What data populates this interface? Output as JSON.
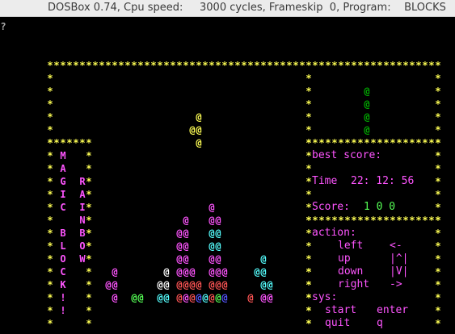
{
  "window": {
    "title": "DOSBox 0.74, Cpu speed:     3000 cycles, Frameskip  0, Program:    BLOCKS"
  },
  "colors": {
    "border": "#ffff55",
    "label": "#ff55ff",
    "score_value": "#55ff55",
    "next_piece": "#00aa00",
    "cursor": "#aaaaaa"
  },
  "game": {
    "title_letters": [
      "M",
      "A",
      "G",
      "I",
      "C",
      "",
      "B",
      "L",
      "O",
      "C",
      "K",
      "!",
      "!"
    ],
    "side_letters": [
      "",
      "",
      "R",
      "A",
      "I",
      "N",
      "B",
      "O",
      "W"
    ],
    "best_score_label": "best score:",
    "time_label": "Time",
    "time_value": "22: 12: 56",
    "score_label": "Score:",
    "score_value": "1 0 0",
    "action_label": "action:",
    "sys_label": "sys:",
    "controls": [
      {
        "name": "left",
        "key": "<-"
      },
      {
        "name": "up",
        "key": "|^|"
      },
      {
        "name": "down",
        "key": "|V|"
      },
      {
        "name": "right",
        "key": "->"
      }
    ],
    "sys_controls": [
      {
        "name": "start",
        "key": "enter"
      },
      {
        "name": "quit",
        "key": "q"
      }
    ]
  }
}
